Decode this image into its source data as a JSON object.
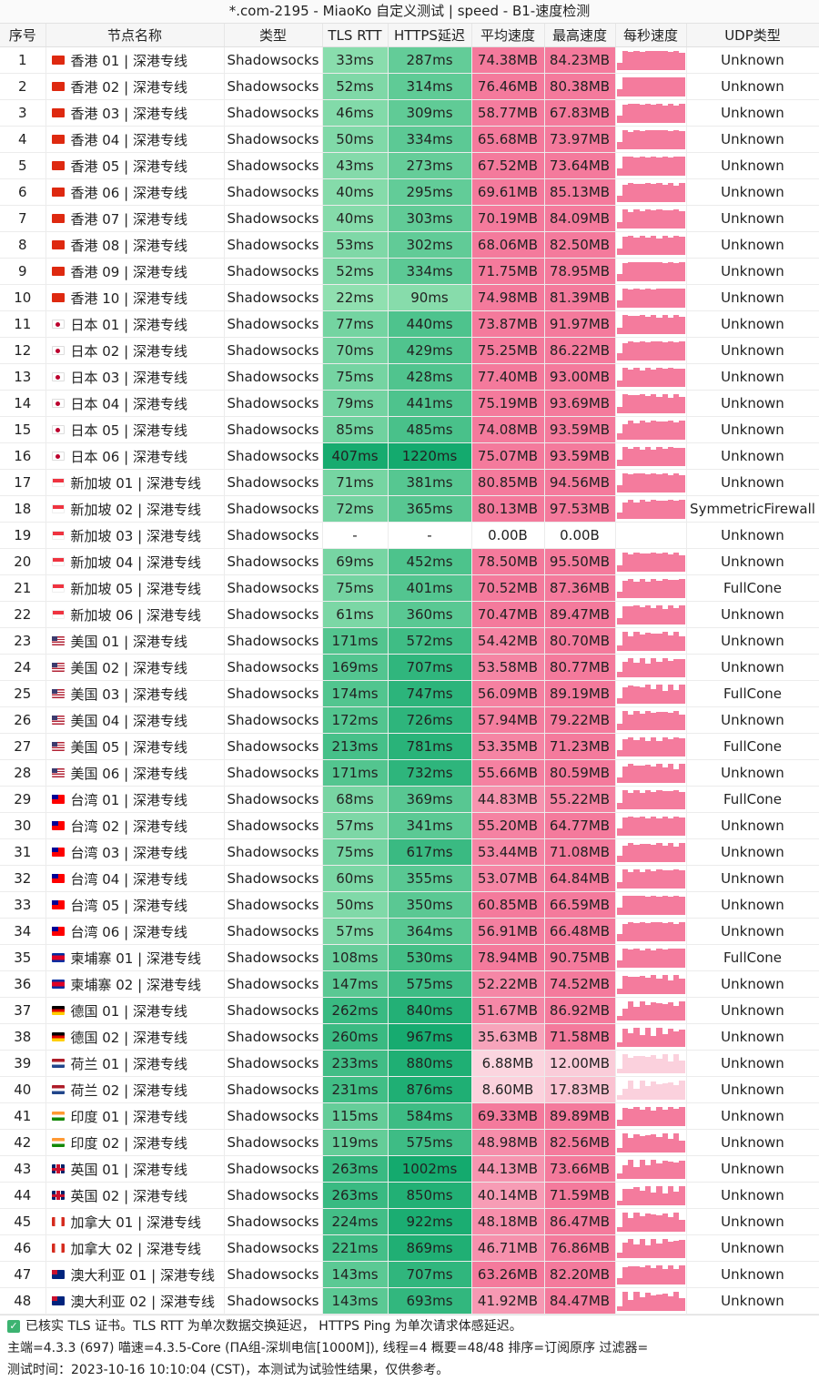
{
  "title": "*.com-2195 - MiaoKo 自定义测试 | speed - B1-速度检测",
  "columns": [
    "序号",
    "节点名称",
    "类型",
    "TLS RTT",
    "HTTPS延迟",
    "平均速度",
    "最高速度",
    "每秒速度",
    "UDP类型"
  ],
  "rows": [
    {
      "idx": "1",
      "flag": "hk",
      "name": "香港 01 | 深港专线",
      "type": "Shadowsocks",
      "tls": "33ms",
      "https": "287ms",
      "avg": "74.38MB",
      "max": "84.23MB",
      "udp": "Unknown"
    },
    {
      "idx": "2",
      "flag": "hk",
      "name": "香港 02 | 深港专线",
      "type": "Shadowsocks",
      "tls": "52ms",
      "https": "314ms",
      "avg": "76.46MB",
      "max": "80.38MB",
      "udp": "Unknown"
    },
    {
      "idx": "3",
      "flag": "hk",
      "name": "香港 03 | 深港专线",
      "type": "Shadowsocks",
      "tls": "46ms",
      "https": "309ms",
      "avg": "58.77MB",
      "max": "67.83MB",
      "udp": "Unknown"
    },
    {
      "idx": "4",
      "flag": "hk",
      "name": "香港 04 | 深港专线",
      "type": "Shadowsocks",
      "tls": "50ms",
      "https": "334ms",
      "avg": "65.68MB",
      "max": "73.97MB",
      "udp": "Unknown"
    },
    {
      "idx": "5",
      "flag": "hk",
      "name": "香港 05 | 深港专线",
      "type": "Shadowsocks",
      "tls": "43ms",
      "https": "273ms",
      "avg": "67.52MB",
      "max": "73.64MB",
      "udp": "Unknown"
    },
    {
      "idx": "6",
      "flag": "hk",
      "name": "香港 06 | 深港专线",
      "type": "Shadowsocks",
      "tls": "40ms",
      "https": "295ms",
      "avg": "69.61MB",
      "max": "85.13MB",
      "udp": "Unknown"
    },
    {
      "idx": "7",
      "flag": "hk",
      "name": "香港 07 | 深港专线",
      "type": "Shadowsocks",
      "tls": "40ms",
      "https": "303ms",
      "avg": "70.19MB",
      "max": "84.09MB",
      "udp": "Unknown"
    },
    {
      "idx": "8",
      "flag": "hk",
      "name": "香港 08 | 深港专线",
      "type": "Shadowsocks",
      "tls": "53ms",
      "https": "302ms",
      "avg": "68.06MB",
      "max": "82.50MB",
      "udp": "Unknown"
    },
    {
      "idx": "9",
      "flag": "hk",
      "name": "香港 09 | 深港专线",
      "type": "Shadowsocks",
      "tls": "52ms",
      "https": "334ms",
      "avg": "71.75MB",
      "max": "78.95MB",
      "udp": "Unknown"
    },
    {
      "idx": "10",
      "flag": "hk",
      "name": "香港 10 | 深港专线",
      "type": "Shadowsocks",
      "tls": "22ms",
      "https": "90ms",
      "avg": "74.98MB",
      "max": "81.39MB",
      "udp": "Unknown"
    },
    {
      "idx": "11",
      "flag": "jp",
      "name": "日本 01 | 深港专线",
      "type": "Shadowsocks",
      "tls": "77ms",
      "https": "440ms",
      "avg": "73.87MB",
      "max": "91.97MB",
      "udp": "Unknown"
    },
    {
      "idx": "12",
      "flag": "jp",
      "name": "日本 02 | 深港专线",
      "type": "Shadowsocks",
      "tls": "70ms",
      "https": "429ms",
      "avg": "75.25MB",
      "max": "86.22MB",
      "udp": "Unknown"
    },
    {
      "idx": "13",
      "flag": "jp",
      "name": "日本 03 | 深港专线",
      "type": "Shadowsocks",
      "tls": "75ms",
      "https": "428ms",
      "avg": "77.40MB",
      "max": "93.00MB",
      "udp": "Unknown"
    },
    {
      "idx": "14",
      "flag": "jp",
      "name": "日本 04 | 深港专线",
      "type": "Shadowsocks",
      "tls": "79ms",
      "https": "441ms",
      "avg": "75.19MB",
      "max": "93.69MB",
      "udp": "Unknown"
    },
    {
      "idx": "15",
      "flag": "jp",
      "name": "日本 05 | 深港专线",
      "type": "Shadowsocks",
      "tls": "85ms",
      "https": "485ms",
      "avg": "74.08MB",
      "max": "93.59MB",
      "udp": "Unknown"
    },
    {
      "idx": "16",
      "flag": "jp",
      "name": "日本 06 | 深港专线",
      "type": "Shadowsocks",
      "tls": "407ms",
      "https": "1220ms",
      "avg": "75.07MB",
      "max": "93.59MB",
      "udp": "Unknown"
    },
    {
      "idx": "17",
      "flag": "sg",
      "name": "新加坡 01 | 深港专线",
      "type": "Shadowsocks",
      "tls": "71ms",
      "https": "381ms",
      "avg": "80.85MB",
      "max": "94.56MB",
      "udp": "Unknown"
    },
    {
      "idx": "18",
      "flag": "sg",
      "name": "新加坡 02 | 深港专线",
      "type": "Shadowsocks",
      "tls": "72ms",
      "https": "365ms",
      "avg": "80.13MB",
      "max": "97.53MB",
      "udp": "SymmetricFirewall"
    },
    {
      "idx": "19",
      "flag": "sg",
      "name": "新加坡 03 | 深港专线",
      "type": "Shadowsocks",
      "tls": "-",
      "https": "-",
      "avg": "0.00B",
      "max": "0.00B",
      "udp": "Unknown"
    },
    {
      "idx": "20",
      "flag": "sg",
      "name": "新加坡 04 | 深港专线",
      "type": "Shadowsocks",
      "tls": "69ms",
      "https": "452ms",
      "avg": "78.50MB",
      "max": "95.50MB",
      "udp": "Unknown"
    },
    {
      "idx": "21",
      "flag": "sg",
      "name": "新加坡 05 | 深港专线",
      "type": "Shadowsocks",
      "tls": "75ms",
      "https": "401ms",
      "avg": "70.52MB",
      "max": "87.36MB",
      "udp": "FullCone"
    },
    {
      "idx": "22",
      "flag": "sg",
      "name": "新加坡 06 | 深港专线",
      "type": "Shadowsocks",
      "tls": "61ms",
      "https": "360ms",
      "avg": "70.47MB",
      "max": "89.47MB",
      "udp": "Unknown"
    },
    {
      "idx": "23",
      "flag": "us",
      "name": "美国 01 | 深港专线",
      "type": "Shadowsocks",
      "tls": "171ms",
      "https": "572ms",
      "avg": "54.42MB",
      "max": "80.70MB",
      "udp": "Unknown"
    },
    {
      "idx": "24",
      "flag": "us",
      "name": "美国 02 | 深港专线",
      "type": "Shadowsocks",
      "tls": "169ms",
      "https": "707ms",
      "avg": "53.58MB",
      "max": "80.77MB",
      "udp": "Unknown"
    },
    {
      "idx": "25",
      "flag": "us",
      "name": "美国 03 | 深港专线",
      "type": "Shadowsocks",
      "tls": "174ms",
      "https": "747ms",
      "avg": "56.09MB",
      "max": "89.19MB",
      "udp": "FullCone"
    },
    {
      "idx": "26",
      "flag": "us",
      "name": "美国 04 | 深港专线",
      "type": "Shadowsocks",
      "tls": "172ms",
      "https": "726ms",
      "avg": "57.94MB",
      "max": "79.22MB",
      "udp": "Unknown"
    },
    {
      "idx": "27",
      "flag": "us",
      "name": "美国 05 | 深港专线",
      "type": "Shadowsocks",
      "tls": "213ms",
      "https": "781ms",
      "avg": "53.35MB",
      "max": "71.23MB",
      "udp": "FullCone"
    },
    {
      "idx": "28",
      "flag": "us",
      "name": "美国 06 | 深港专线",
      "type": "Shadowsocks",
      "tls": "171ms",
      "https": "732ms",
      "avg": "55.66MB",
      "max": "80.59MB",
      "udp": "Unknown"
    },
    {
      "idx": "29",
      "flag": "tw",
      "name": "台湾 01 | 深港专线",
      "type": "Shadowsocks",
      "tls": "68ms",
      "https": "369ms",
      "avg": "44.83MB",
      "max": "55.22MB",
      "udp": "FullCone"
    },
    {
      "idx": "30",
      "flag": "tw",
      "name": "台湾 02 | 深港专线",
      "type": "Shadowsocks",
      "tls": "57ms",
      "https": "341ms",
      "avg": "55.20MB",
      "max": "64.77MB",
      "udp": "Unknown"
    },
    {
      "idx": "31",
      "flag": "tw",
      "name": "台湾 03 | 深港专线",
      "type": "Shadowsocks",
      "tls": "75ms",
      "https": "617ms",
      "avg": "53.44MB",
      "max": "71.08MB",
      "udp": "Unknown"
    },
    {
      "idx": "32",
      "flag": "tw",
      "name": "台湾 04 | 深港专线",
      "type": "Shadowsocks",
      "tls": "60ms",
      "https": "355ms",
      "avg": "53.07MB",
      "max": "64.84MB",
      "udp": "Unknown"
    },
    {
      "idx": "33",
      "flag": "tw",
      "name": "台湾 05 | 深港专线",
      "type": "Shadowsocks",
      "tls": "50ms",
      "https": "350ms",
      "avg": "60.85MB",
      "max": "66.59MB",
      "udp": "Unknown"
    },
    {
      "idx": "34",
      "flag": "tw",
      "name": "台湾 06 | 深港专线",
      "type": "Shadowsocks",
      "tls": "57ms",
      "https": "364ms",
      "avg": "56.91MB",
      "max": "66.48MB",
      "udp": "Unknown"
    },
    {
      "idx": "35",
      "flag": "kh",
      "name": "柬埔寨 01 | 深港专线",
      "type": "Shadowsocks",
      "tls": "108ms",
      "https": "530ms",
      "avg": "78.94MB",
      "max": "90.75MB",
      "udp": "FullCone"
    },
    {
      "idx": "36",
      "flag": "kh",
      "name": "柬埔寨 02 | 深港专线",
      "type": "Shadowsocks",
      "tls": "147ms",
      "https": "575ms",
      "avg": "52.22MB",
      "max": "74.52MB",
      "udp": "Unknown"
    },
    {
      "idx": "37",
      "flag": "de",
      "name": "德国 01 | 深港专线",
      "type": "Shadowsocks",
      "tls": "262ms",
      "https": "840ms",
      "avg": "51.67MB",
      "max": "86.92MB",
      "udp": "Unknown"
    },
    {
      "idx": "38",
      "flag": "de",
      "name": "德国 02 | 深港专线",
      "type": "Shadowsocks",
      "tls": "260ms",
      "https": "967ms",
      "avg": "35.63MB",
      "max": "71.58MB",
      "udp": "Unknown"
    },
    {
      "idx": "39",
      "flag": "nl",
      "name": "荷兰 01 | 深港专线",
      "type": "Shadowsocks",
      "tls": "233ms",
      "https": "880ms",
      "avg": "6.88MB",
      "max": "12.00MB",
      "udp": "Unknown"
    },
    {
      "idx": "40",
      "flag": "nl",
      "name": "荷兰 02 | 深港专线",
      "type": "Shadowsocks",
      "tls": "231ms",
      "https": "876ms",
      "avg": "8.60MB",
      "max": "17.83MB",
      "udp": "Unknown"
    },
    {
      "idx": "41",
      "flag": "in",
      "name": "印度 01 | 深港专线",
      "type": "Shadowsocks",
      "tls": "115ms",
      "https": "584ms",
      "avg": "69.33MB",
      "max": "89.89MB",
      "udp": "Unknown"
    },
    {
      "idx": "42",
      "flag": "in",
      "name": "印度 02 | 深港专线",
      "type": "Shadowsocks",
      "tls": "119ms",
      "https": "575ms",
      "avg": "48.98MB",
      "max": "82.56MB",
      "udp": "Unknown"
    },
    {
      "idx": "43",
      "flag": "gb",
      "name": "英国 01 | 深港专线",
      "type": "Shadowsocks",
      "tls": "263ms",
      "https": "1002ms",
      "avg": "44.13MB",
      "max": "73.66MB",
      "udp": "Unknown"
    },
    {
      "idx": "44",
      "flag": "gb",
      "name": "英国 02 | 深港专线",
      "type": "Shadowsocks",
      "tls": "263ms",
      "https": "850ms",
      "avg": "40.14MB",
      "max": "71.59MB",
      "udp": "Unknown"
    },
    {
      "idx": "45",
      "flag": "ca",
      "name": "加拿大 01 | 深港专线",
      "type": "Shadowsocks",
      "tls": "224ms",
      "https": "922ms",
      "avg": "48.18MB",
      "max": "86.47MB",
      "udp": "Unknown"
    },
    {
      "idx": "46",
      "flag": "ca",
      "name": "加拿大 02 | 深港专线",
      "type": "Shadowsocks",
      "tls": "221ms",
      "https": "869ms",
      "avg": "46.71MB",
      "max": "76.86MB",
      "udp": "Unknown"
    },
    {
      "idx": "47",
      "flag": "au",
      "name": "澳大利亚 01 | 深港专线",
      "type": "Shadowsocks",
      "tls": "143ms",
      "https": "707ms",
      "avg": "63.26MB",
      "max": "82.20MB",
      "udp": "Unknown"
    },
    {
      "idx": "48",
      "flag": "au",
      "name": "澳大利亚 02 | 深港专线",
      "type": "Shadowsocks",
      "tls": "143ms",
      "https": "693ms",
      "avg": "41.92MB",
      "max": "84.47MB",
      "udp": "Unknown"
    }
  ],
  "footer": {
    "line1": "已核实 TLS 证书。TLS RTT 为单次数据交换延迟， HTTPS Ping 为单次请求体感延迟。",
    "line2": "主端=4.3.3 (697) 喵速=4.3.5-Core (ΠA组-深圳电信[1000M]), 线程=4 概要=48/48 排序=订阅原序 过滤器=",
    "line3": "测试时间：2023-10-16 10:10:04 (CST)，本测试为试验性结果，仅供参考。"
  }
}
